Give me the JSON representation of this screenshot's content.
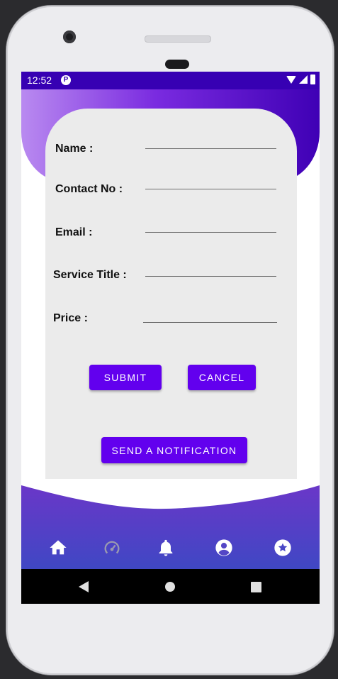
{
  "status_bar": {
    "time": "12:52",
    "app_icon_letter": "P"
  },
  "form": {
    "fields": [
      {
        "label": "Name :"
      },
      {
        "label": "Contact No :"
      },
      {
        "label": "Email :"
      },
      {
        "label": "Service Title :"
      },
      {
        "label": "Price :"
      }
    ]
  },
  "buttons": {
    "submit": "SUBMIT",
    "cancel": "CANCEL",
    "notify": "SEND A NOTIFICATION"
  },
  "bottom_nav": {
    "items": [
      "home-icon",
      "speedometer-icon",
      "bell-icon",
      "account-icon",
      "star-icon"
    ],
    "active": "speedometer-icon"
  },
  "colors": {
    "status_bar": "#3700b3",
    "accent": "#6200ee",
    "nav_gradient_top": "#6a37c8",
    "nav_gradient_bottom": "#3e48c4"
  }
}
